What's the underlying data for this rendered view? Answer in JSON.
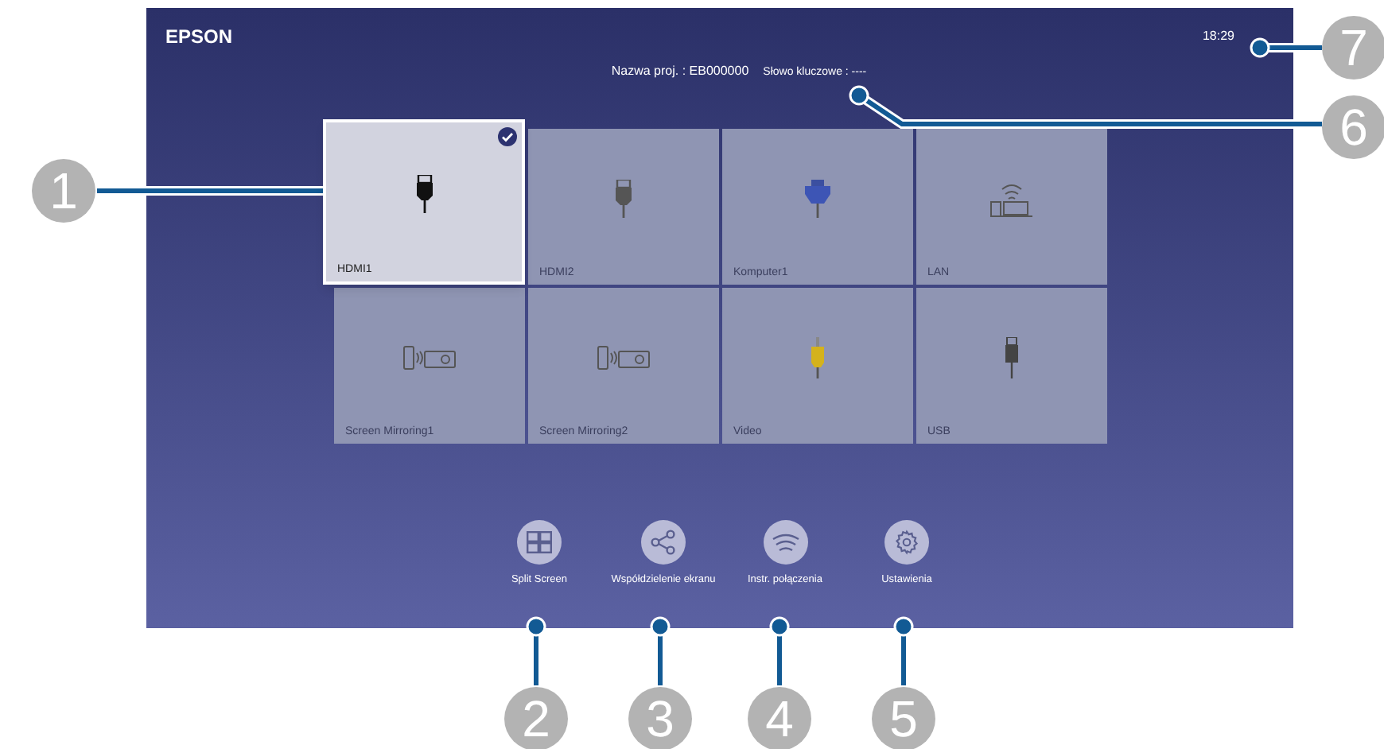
{
  "screen": {
    "brand": "EPSON",
    "project_name": "Nazwa proj. : EB000000",
    "keyword": "Słowo kluczowe : ----",
    "time": "18:29"
  },
  "sources": [
    {
      "label": "HDMI1",
      "kind": "hdmi",
      "selected": true
    },
    {
      "label": "HDMI2",
      "kind": "hdmi",
      "selected": false
    },
    {
      "label": "Komputer1",
      "kind": "vga",
      "selected": false
    },
    {
      "label": "LAN",
      "kind": "lan",
      "selected": false
    },
    {
      "label": "Screen Mirroring1",
      "kind": "mirroring",
      "selected": false
    },
    {
      "label": "Screen Mirroring2",
      "kind": "mirroring",
      "selected": false
    },
    {
      "label": "Video",
      "kind": "video",
      "selected": false
    },
    {
      "label": "USB",
      "kind": "usb",
      "selected": false
    }
  ],
  "actions": [
    {
      "label": "Split Screen",
      "kind": "split"
    },
    {
      "label": "Współdzielenie ekranu",
      "kind": "share"
    },
    {
      "label": "Instr. połączenia",
      "kind": "wireless"
    },
    {
      "label": "Ustawienia",
      "kind": "settings"
    }
  ],
  "callouts": [
    {
      "number": "1"
    },
    {
      "number": "2"
    },
    {
      "number": "3"
    },
    {
      "number": "4"
    },
    {
      "number": "5"
    },
    {
      "number": "6"
    },
    {
      "number": "7"
    }
  ]
}
